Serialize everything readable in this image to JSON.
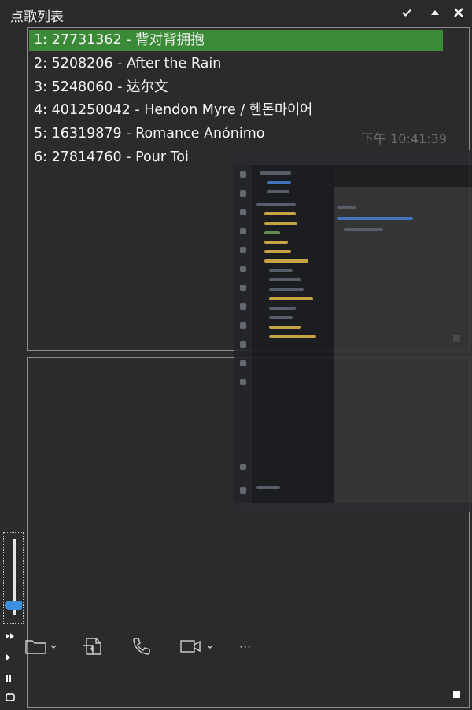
{
  "window": {
    "title": "点歌列表",
    "controls": [
      {
        "name": "check-icon"
      },
      {
        "name": "triangle-up-icon"
      },
      {
        "name": "close-icon"
      }
    ]
  },
  "playlist": {
    "songs": [
      {
        "label": "1: 27731362 - 背对背拥抱",
        "active": true
      },
      {
        "label": "2: 5208206 - After the Rain",
        "active": false
      },
      {
        "label": "3: 5248060 - 达尔文",
        "active": false
      },
      {
        "label": "4: 401250042 - Hendon Myre / 헨돈마이어",
        "active": false
      },
      {
        "label": "5: 16319879 - Romance Anónimo",
        "active": false
      },
      {
        "label": "6: 27814760 - Pour Toi",
        "active": false
      }
    ],
    "clock": "下午 10:41:39"
  },
  "left_controls": {
    "volume_level": 0.12,
    "buttons": [
      "fast-forward-icon",
      "play-icon",
      "pause-icon",
      "loop-icon"
    ]
  },
  "toolbar": {
    "items": [
      "folder-icon",
      "file-share-icon",
      "phone-icon",
      "video-camera-icon",
      "more-icon"
    ],
    "more_label": "···"
  },
  "colors": {
    "background": "#2b2b2b",
    "active_row": "#3a8a37",
    "volume_thumb": "#3d8fe0",
    "panel_border": "#8c8c8c"
  }
}
